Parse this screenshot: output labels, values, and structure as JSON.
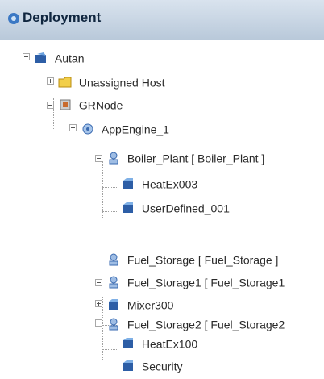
{
  "header": {
    "title": "Deployment",
    "icon": "deployment-icon"
  },
  "tree": {
    "root": {
      "label": "Autan",
      "icon": "galaxy-icon"
    },
    "unassigned": {
      "label": "Unassigned Host",
      "icon": "folder-icon"
    },
    "grnode": {
      "label": "GRNode",
      "icon": "platform-icon"
    },
    "appengine": {
      "label": "AppEngine_1",
      "icon": "engine-icon"
    },
    "boiler": {
      "label": "Boiler_Plant [ Boiler_Plant ]",
      "icon": "area-icon"
    },
    "heatex": {
      "label": "HeatEx003",
      "icon": "object-icon"
    },
    "userdefined": {
      "label": "UserDefined_001",
      "icon": "object-icon"
    },
    "fuel": {
      "label": "Fuel_Storage [ Fuel_Storage ]",
      "icon": "area-icon"
    },
    "fuel1": {
      "label": "Fuel_Storage1 [ Fuel_Storage1",
      "icon": "area-icon"
    },
    "mixer": {
      "label": "Mixer300",
      "icon": "object-icon"
    },
    "fuel2": {
      "label": "Fuel_Storage2 [ Fuel_Storage2",
      "icon": "area-icon"
    },
    "heatex100": {
      "label": "HeatEx100",
      "icon": "object-icon"
    },
    "security": {
      "label": "Security",
      "icon": "object-icon"
    }
  }
}
